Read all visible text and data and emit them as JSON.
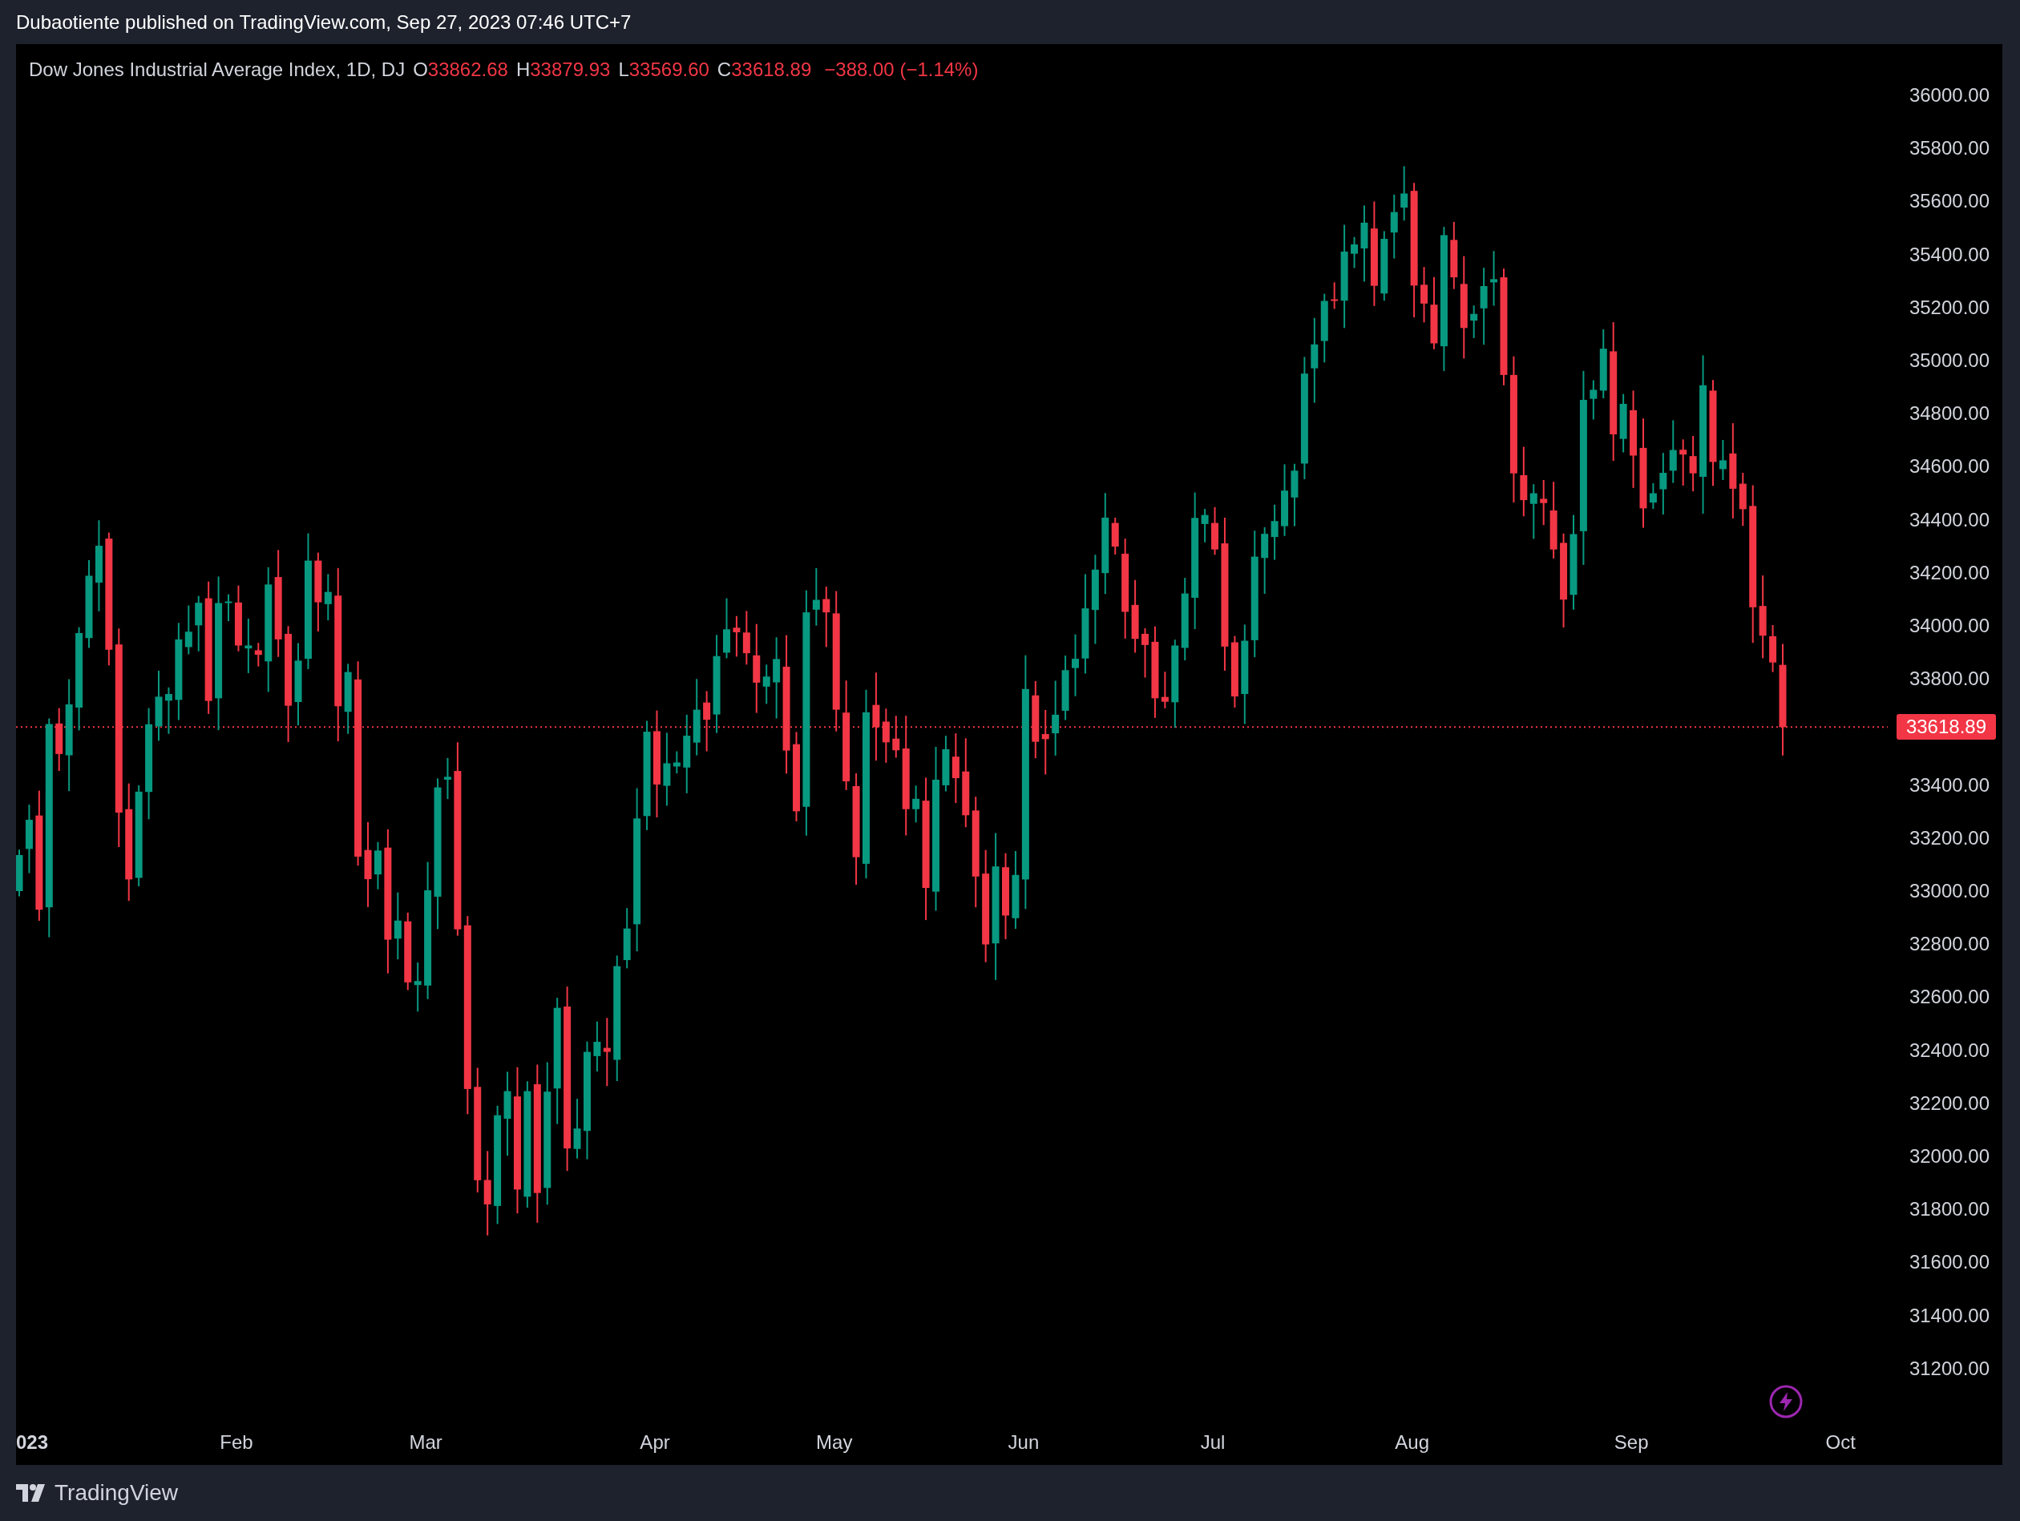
{
  "header": {
    "text": "Dubaotiente published on TradingView.com, Sep 27, 2023 07:46 UTC+7"
  },
  "legend": {
    "symbol": "Dow Jones Industrial Average Index, 1D, DJ",
    "values": [
      {
        "key": "O",
        "value": "33862.68"
      },
      {
        "key": "H",
        "value": "33879.93"
      },
      {
        "key": "L",
        "value": "33569.60"
      },
      {
        "key": "C",
        "value": "33618.89"
      }
    ],
    "change": "−388.00 (−1.14%)"
  },
  "price_axis_upper": [
    "36000.00",
    "35800.00",
    "35600.00",
    "35400.00",
    "35200.00",
    "35000.00",
    "34800.00",
    "34600.00",
    "34400.00",
    "34200.00",
    "34000.00",
    "33800.00"
  ],
  "price_axis_lower": [
    "33400.00",
    "33200.00",
    "33000.00",
    "32800.00",
    "32600.00",
    "32400.00",
    "32200.00",
    "32000.00",
    "31800.00",
    "31600.00",
    "31400.00",
    "31200.00"
  ],
  "last_price": "33618.89",
  "time_axis": [
    "023",
    "Feb",
    "Mar",
    "Apr",
    "May",
    "Jun",
    "Jul",
    "Aug",
    "Sep",
    "Oct"
  ],
  "footer": {
    "brand": "TradingView"
  }
}
